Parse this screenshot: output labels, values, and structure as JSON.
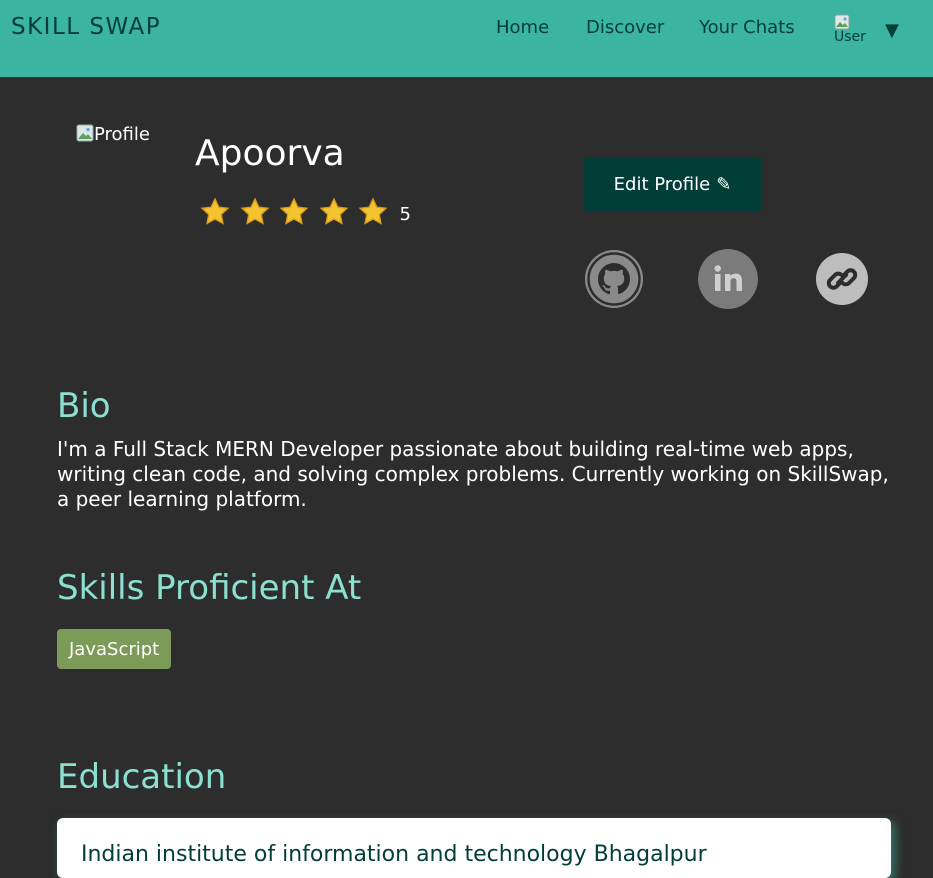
{
  "navbar": {
    "brand": "SKILL SWAP",
    "links": [
      "Home",
      "Discover",
      "Your Chats"
    ],
    "avatar_alt": "User",
    "caret": "▼"
  },
  "profile": {
    "image_alt": "Profile",
    "name": "Apoorva",
    "rating_value": "5",
    "stars": 5,
    "edit_label": "Edit Profile",
    "edit_icon": "✎",
    "social_icons": [
      "github-icon",
      "linkedin-icon",
      "link-icon"
    ]
  },
  "bio": {
    "title": "Bio",
    "text": "I'm a Full Stack MERN Developer passionate about building real-time web apps, writing clean code, and solving complex problems. Currently working on SkillSwap, a peer learning platform."
  },
  "skills": {
    "title": "Skills Proficient At",
    "items": [
      "JavaScript"
    ]
  },
  "education": {
    "title": "Education",
    "school": "Indian institute of information and technology Bhagalpur"
  },
  "colors": {
    "navbar": "#3bb4a1",
    "dark": "#013e38",
    "background": "#2d2d2d",
    "heading": "#8be0d0",
    "skill_tag": "#7c9a58",
    "star": "#f4c430"
  }
}
